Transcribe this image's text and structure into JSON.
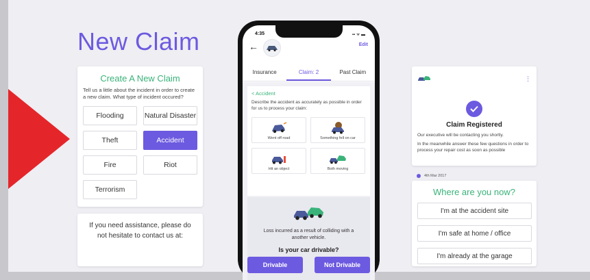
{
  "page_title": "New Claim",
  "create_card": {
    "heading": "Create A New Claim",
    "description": "Tell us a little about the incident in order to create a new claim. What type of incident occured?",
    "options": [
      "Flooding",
      "Natural Disaster",
      "Theft",
      "Accident",
      "Fire",
      "Riot",
      "Terrorism"
    ],
    "selected": "Accident"
  },
  "assist_card": {
    "text": "If you need assistance, please do not hesitate to contact us at:"
  },
  "phone": {
    "time": "4:35",
    "status_icons": "▪▪ ᯤ ▬",
    "back_icon": "←",
    "edit_label": "Edit",
    "tabs": [
      "Insurance",
      "Claim: 2",
      "Past Claim"
    ],
    "active_tab": "Claim: 2",
    "breadcrumb": "< Accident",
    "description": "Describe the accident as accurately as possible in order for us to process your claim:",
    "incident_tiles": [
      "Went off road",
      "Something fell on car",
      "Hit an object",
      "Both moving"
    ],
    "loss_text": "Loss incurred as a result of colliding with a another vehicle.",
    "question": "Is your car drivable?",
    "drivable_label": "Drivable",
    "not_drivable_label": "Not Drivable"
  },
  "registered_card": {
    "menu_icon": "⋮",
    "title": "Claim Registered",
    "line1": "Our executive will be contacting you shortly.",
    "line2": "In the meanwhile answer these few questions in order to process your repair cost as soon as possible"
  },
  "date_label": "4th Mar 2017",
  "where_card": {
    "heading": "Where are you now?",
    "options": [
      "I'm at the accident site",
      "I'm safe at home / office",
      "I'm already at the garage"
    ]
  },
  "colors": {
    "accent": "#6c5ae0",
    "green": "#3ab37a",
    "arrow_red": "#e4262b"
  }
}
